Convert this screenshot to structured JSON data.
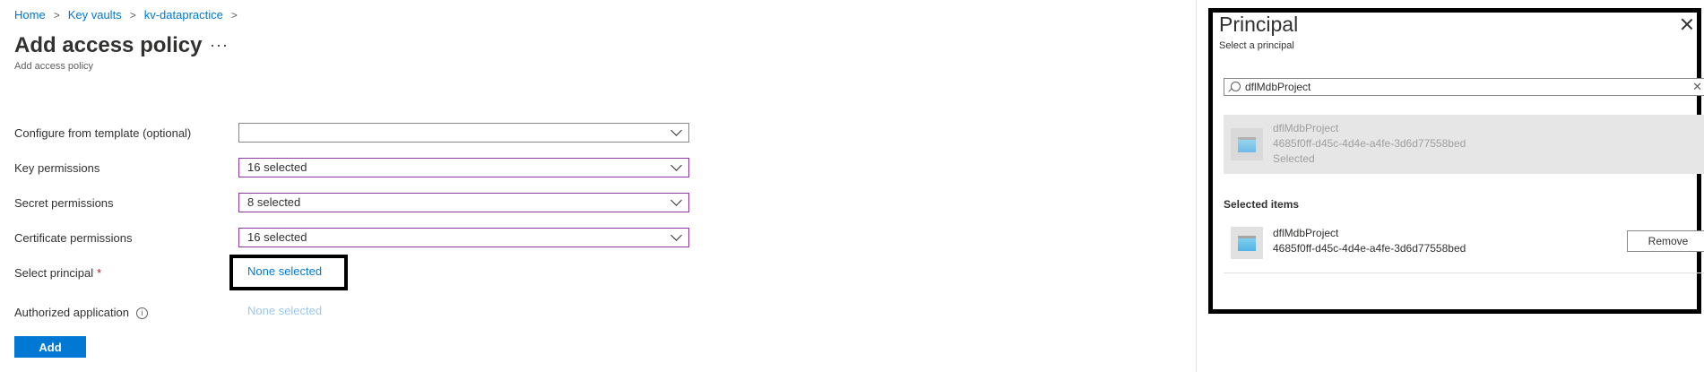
{
  "breadcrumb": [
    "Home",
    "Key vaults",
    "kv-datapractice"
  ],
  "page": {
    "title": "Add access policy",
    "more_label": "···",
    "subtitle": "Add access policy"
  },
  "form": {
    "template_label": "Configure from template (optional)",
    "template_value": "",
    "key_label": "Key permissions",
    "key_value": "16 selected",
    "secret_label": "Secret permissions",
    "secret_value": "8 selected",
    "cert_label": "Certificate permissions",
    "cert_value": "16 selected",
    "principal_label": "Select principal",
    "principal_required": "*",
    "principal_value": "None selected",
    "auth_label": "Authorized application",
    "auth_value": "None selected",
    "add_label": "Add"
  },
  "panel": {
    "title": "Principal",
    "subtitle": "Select a principal",
    "search_value": "dflMdbProject",
    "result": {
      "name": "dflMdbProject",
      "id": "4685f0ff-d45c-4d4e-a4fe-3d6d77558bed",
      "status": "Selected"
    },
    "selected_heading": "Selected items",
    "selected": {
      "name": "dflMdbProject",
      "id": "4685f0ff-d45c-4d4e-a4fe-3d6d77558bed",
      "remove_label": "Remove"
    }
  },
  "icons": {
    "chevron": "chevron-down-icon",
    "close": "close-icon",
    "search": "search-icon",
    "info": "info-icon",
    "app": "app-registration-icon"
  },
  "colors": {
    "accent": "#0078d4",
    "selected_border": "#8e3aa6",
    "highlight_box": "#000000"
  }
}
